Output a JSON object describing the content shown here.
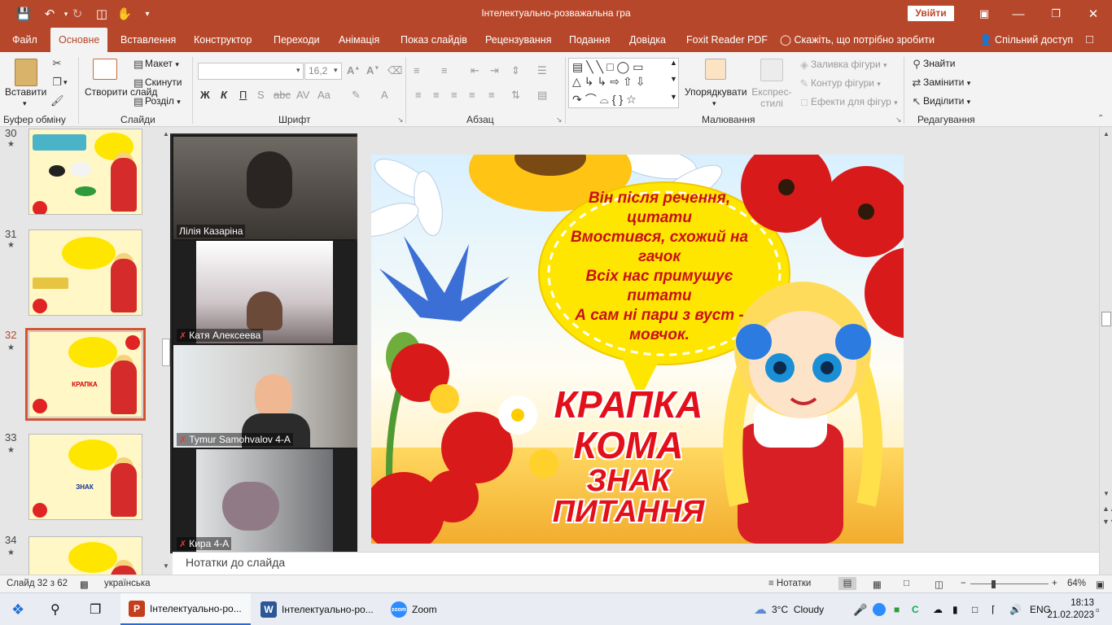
{
  "window": {
    "title": "Інтелектуально-розважальна гра",
    "signin": "Увійти"
  },
  "tabs": [
    "Файл",
    "Основне",
    "Вставлення",
    "Конструктор",
    "Переходи",
    "Анімація",
    "Показ слайдів",
    "Рецензування",
    "Подання",
    "Довідка",
    "Foxit Reader PDF"
  ],
  "tell_me": "Скажіть, що потрібно зробити",
  "share": "Спільний доступ",
  "ribbon": {
    "groups": {
      "clipboard": "Буфер обміну",
      "slides": "Слайди",
      "font": "Шрифт",
      "paragraph": "Абзац",
      "drawing": "Малювання",
      "editing": "Редагування"
    },
    "paste": "Вставити",
    "new_slide": "Створити слайд",
    "layout": "Макет",
    "reset": "Скинути",
    "section": "Розділ",
    "font_name": "",
    "font_size": "16,2",
    "arrange": "Упорядкувати",
    "quick_styles": "Експрес-стилі",
    "shape_fill": "Заливка фігури",
    "shape_outline": "Контур фігури",
    "shape_effects": "Ефекти для фігур",
    "find": "Знайти",
    "replace": "Замінити",
    "select": "Виділити"
  },
  "thumbnails": [
    {
      "num": "30",
      "active": false
    },
    {
      "num": "31",
      "active": false
    },
    {
      "num": "32",
      "active": true
    },
    {
      "num": "33",
      "active": false
    },
    {
      "num": "34",
      "active": false
    }
  ],
  "slide": {
    "riddle_lines": [
      "Він після речення,",
      "цитати",
      "Вмостився, схожий на",
      "гачок",
      "Всіх нас примушує",
      "питати",
      "А сам ні пари з вуст -",
      "мовчок."
    ],
    "answer_lines": [
      "КРАПКА",
      "КОМА",
      "ЗНАК",
      "ПИТАННЯ"
    ]
  },
  "participants": [
    {
      "name": "Лілія Казаріна",
      "muted": false,
      "active": false
    },
    {
      "name": "Катя Алексеева",
      "muted": true,
      "active": false
    },
    {
      "name": "Tymur Samohvalov 4-А",
      "muted": true,
      "active": true
    },
    {
      "name": "Кира 4-А",
      "muted": true,
      "active": false
    }
  ],
  "notes_placeholder": "Нотатки до слайда",
  "status": {
    "slide_counter": "Слайд 32 з 62",
    "language": "українська",
    "notes_button": "Нотатки",
    "zoom": "64%"
  },
  "taskbar": {
    "apps": [
      "Інтелектуально-ро...",
      "Інтелектуально-ро...",
      "Zoom"
    ],
    "weather_temp": "3°C",
    "weather_desc": "Cloudy",
    "lang": "ENG",
    "time": "18:13",
    "date": "21.02.2023"
  },
  "colors": {
    "ppt_accent": "#b7472a",
    "slide_text": "#cc0000",
    "bubble": "#ffe600"
  }
}
